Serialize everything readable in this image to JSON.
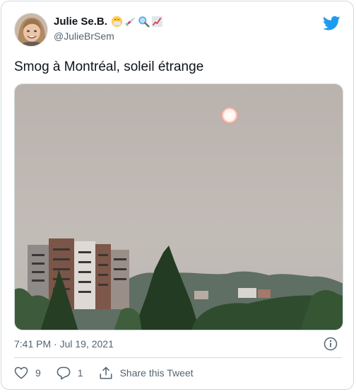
{
  "author": {
    "display_name": "Julie Se.B.",
    "emojis": [
      "face-with-medical-mask-emoji",
      "syringe-emoji",
      "magnifying-glass-emoji",
      "chart-increasing-emoji"
    ],
    "handle": "@JulieBrSem"
  },
  "tweet": {
    "text": "Smog à Montréal, soleil étrange",
    "timestamp": "7:41 PM · Jul 19, 2021"
  },
  "actions": {
    "likes": "9",
    "replies": "1",
    "share_label": "Share this Tweet"
  },
  "colors": {
    "brand": "#1d9bf0",
    "secondary_text": "#536471",
    "border": "#cfd9de",
    "smog_sky": "#bdb6b1"
  },
  "icons": [
    "twitter-logo-icon",
    "info-icon",
    "heart-icon",
    "reply-icon",
    "share-icon"
  ]
}
